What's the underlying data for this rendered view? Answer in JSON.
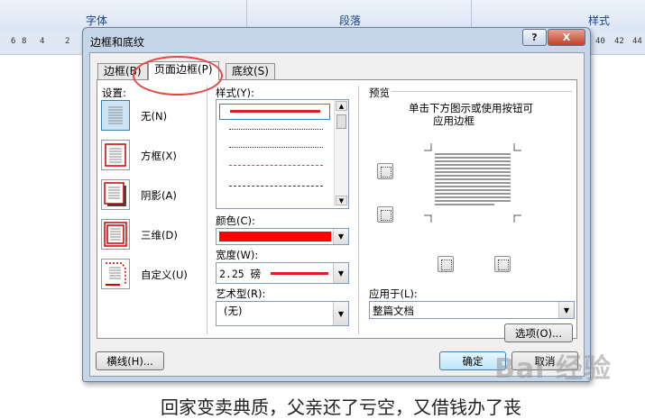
{
  "background": {
    "ribbon_groups": [
      "字体",
      "段落",
      "样式"
    ],
    "ruler_left": [
      "6",
      "8",
      "4",
      "2"
    ],
    "ruler_right": [
      "40",
      "42",
      "44"
    ],
    "doc_text": "回家变卖典质，父亲还了亏空，又借钱办了丧",
    "watermark": "Bai 经验"
  },
  "dialog": {
    "title": "边框和底纹",
    "help_label": "?",
    "close_label": "X",
    "tabs": [
      {
        "label": "边框(B)"
      },
      {
        "label": "页面边框(P)"
      },
      {
        "label": "底纹(S)"
      }
    ],
    "settings": {
      "label": "设置:",
      "items": [
        {
          "label": "无(N)"
        },
        {
          "label": "方框(X)"
        },
        {
          "label": "阴影(A)"
        },
        {
          "label": "三维(D)"
        },
        {
          "label": "自定义(U)"
        }
      ]
    },
    "style": {
      "label": "样式(Y):"
    },
    "color": {
      "label": "颜色(C):",
      "value_color": "#ff0000"
    },
    "width": {
      "label": "宽度(W):",
      "value": "2.25 磅"
    },
    "art": {
      "label": "艺术型(R):",
      "value": "(无)"
    },
    "preview": {
      "label": "预览",
      "hint_line1": "单击下方图示或使用按钮可",
      "hint_line2": "应用边框"
    },
    "apply_to": {
      "label": "应用于(L):",
      "value": "整篇文档"
    },
    "options_label": "选项(O)...",
    "hline_label": "横线(H)...",
    "ok_label": "确定",
    "cancel_label": "取消"
  },
  "colors": {
    "accent_red": "#e02020",
    "annotation_circle": "#e84545",
    "selected_border": "#3c7fb1"
  }
}
